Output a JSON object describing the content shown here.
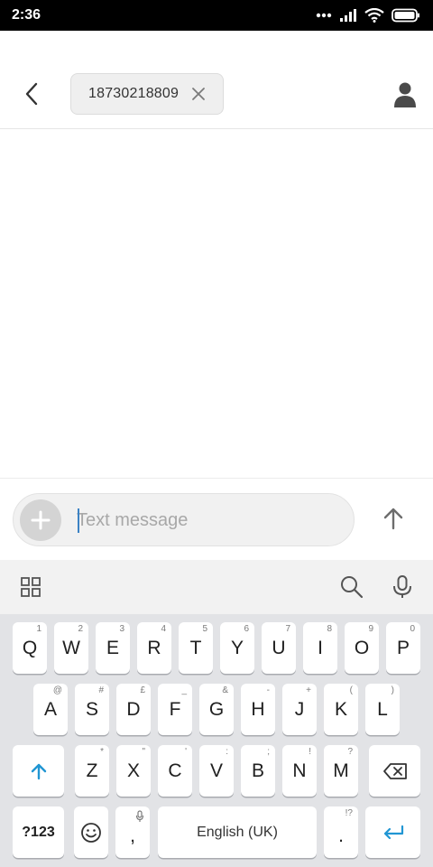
{
  "status": {
    "time": "2:36"
  },
  "header": {
    "recipient": "18730218809"
  },
  "composer": {
    "placeholder": "Text message",
    "value": ""
  },
  "keyboard": {
    "row1": [
      {
        "label": "Q",
        "hint": "1"
      },
      {
        "label": "W",
        "hint": "2"
      },
      {
        "label": "E",
        "hint": "3"
      },
      {
        "label": "R",
        "hint": "4"
      },
      {
        "label": "T",
        "hint": "5"
      },
      {
        "label": "Y",
        "hint": "6"
      },
      {
        "label": "U",
        "hint": "7"
      },
      {
        "label": "I",
        "hint": "8"
      },
      {
        "label": "O",
        "hint": "9"
      },
      {
        "label": "P",
        "hint": "0"
      }
    ],
    "row2": [
      {
        "label": "A",
        "hint": "@"
      },
      {
        "label": "S",
        "hint": "#"
      },
      {
        "label": "D",
        "hint": "£"
      },
      {
        "label": "F",
        "hint": "_"
      },
      {
        "label": "G",
        "hint": "&"
      },
      {
        "label": "H",
        "hint": "-"
      },
      {
        "label": "J",
        "hint": "+"
      },
      {
        "label": "K",
        "hint": "("
      },
      {
        "label": "L",
        "hint": ")"
      }
    ],
    "row3": [
      {
        "label": "Z",
        "hint": "*"
      },
      {
        "label": "X",
        "hint": "\""
      },
      {
        "label": "C",
        "hint": "'"
      },
      {
        "label": "V",
        "hint": ":"
      },
      {
        "label": "B",
        "hint": ";"
      },
      {
        "label": "N",
        "hint": "!"
      },
      {
        "label": "M",
        "hint": "?"
      }
    ],
    "symbols_label": "?123",
    "comma_label": ",",
    "space_label": "English (UK)",
    "period_label": ".",
    "period_hint": "!?"
  },
  "colors": {
    "accent": "#2196d3",
    "keyboard_bg": "#e2e3e6"
  },
  "icons": [
    "back-arrow-icon",
    "close-icon",
    "contact-icon",
    "add-icon",
    "send-arrow-icon",
    "grid-icon",
    "search-icon",
    "mic-icon",
    "shift-icon",
    "backspace-icon",
    "emoji-icon",
    "enter-icon"
  ]
}
